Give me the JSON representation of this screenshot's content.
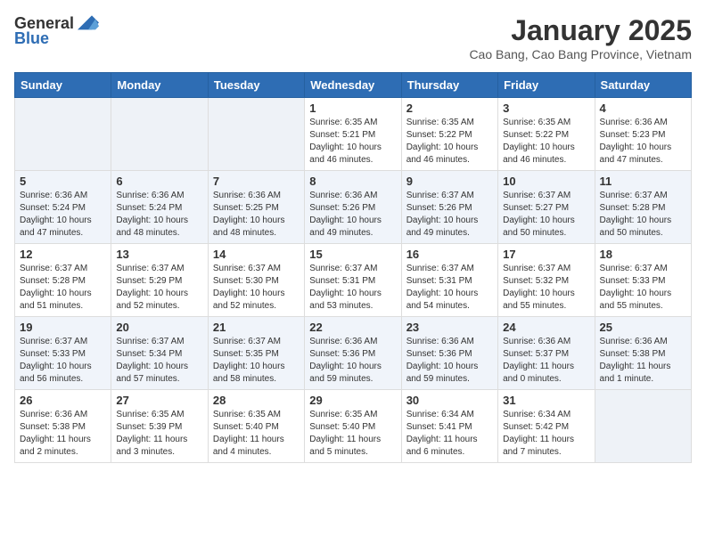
{
  "header": {
    "logo_general": "General",
    "logo_blue": "Blue",
    "month_title": "January 2025",
    "location": "Cao Bang, Cao Bang Province, Vietnam"
  },
  "days_of_week": [
    "Sunday",
    "Monday",
    "Tuesday",
    "Wednesday",
    "Thursday",
    "Friday",
    "Saturday"
  ],
  "weeks": [
    [
      {
        "day": "",
        "info": ""
      },
      {
        "day": "",
        "info": ""
      },
      {
        "day": "",
        "info": ""
      },
      {
        "day": "1",
        "info": "Sunrise: 6:35 AM\nSunset: 5:21 PM\nDaylight: 10 hours\nand 46 minutes."
      },
      {
        "day": "2",
        "info": "Sunrise: 6:35 AM\nSunset: 5:22 PM\nDaylight: 10 hours\nand 46 minutes."
      },
      {
        "day": "3",
        "info": "Sunrise: 6:35 AM\nSunset: 5:22 PM\nDaylight: 10 hours\nand 46 minutes."
      },
      {
        "day": "4",
        "info": "Sunrise: 6:36 AM\nSunset: 5:23 PM\nDaylight: 10 hours\nand 47 minutes."
      }
    ],
    [
      {
        "day": "5",
        "info": "Sunrise: 6:36 AM\nSunset: 5:24 PM\nDaylight: 10 hours\nand 47 minutes."
      },
      {
        "day": "6",
        "info": "Sunrise: 6:36 AM\nSunset: 5:24 PM\nDaylight: 10 hours\nand 48 minutes."
      },
      {
        "day": "7",
        "info": "Sunrise: 6:36 AM\nSunset: 5:25 PM\nDaylight: 10 hours\nand 48 minutes."
      },
      {
        "day": "8",
        "info": "Sunrise: 6:36 AM\nSunset: 5:26 PM\nDaylight: 10 hours\nand 49 minutes."
      },
      {
        "day": "9",
        "info": "Sunrise: 6:37 AM\nSunset: 5:26 PM\nDaylight: 10 hours\nand 49 minutes."
      },
      {
        "day": "10",
        "info": "Sunrise: 6:37 AM\nSunset: 5:27 PM\nDaylight: 10 hours\nand 50 minutes."
      },
      {
        "day": "11",
        "info": "Sunrise: 6:37 AM\nSunset: 5:28 PM\nDaylight: 10 hours\nand 50 minutes."
      }
    ],
    [
      {
        "day": "12",
        "info": "Sunrise: 6:37 AM\nSunset: 5:28 PM\nDaylight: 10 hours\nand 51 minutes."
      },
      {
        "day": "13",
        "info": "Sunrise: 6:37 AM\nSunset: 5:29 PM\nDaylight: 10 hours\nand 52 minutes."
      },
      {
        "day": "14",
        "info": "Sunrise: 6:37 AM\nSunset: 5:30 PM\nDaylight: 10 hours\nand 52 minutes."
      },
      {
        "day": "15",
        "info": "Sunrise: 6:37 AM\nSunset: 5:31 PM\nDaylight: 10 hours\nand 53 minutes."
      },
      {
        "day": "16",
        "info": "Sunrise: 6:37 AM\nSunset: 5:31 PM\nDaylight: 10 hours\nand 54 minutes."
      },
      {
        "day": "17",
        "info": "Sunrise: 6:37 AM\nSunset: 5:32 PM\nDaylight: 10 hours\nand 55 minutes."
      },
      {
        "day": "18",
        "info": "Sunrise: 6:37 AM\nSunset: 5:33 PM\nDaylight: 10 hours\nand 55 minutes."
      }
    ],
    [
      {
        "day": "19",
        "info": "Sunrise: 6:37 AM\nSunset: 5:33 PM\nDaylight: 10 hours\nand 56 minutes."
      },
      {
        "day": "20",
        "info": "Sunrise: 6:37 AM\nSunset: 5:34 PM\nDaylight: 10 hours\nand 57 minutes."
      },
      {
        "day": "21",
        "info": "Sunrise: 6:37 AM\nSunset: 5:35 PM\nDaylight: 10 hours\nand 58 minutes."
      },
      {
        "day": "22",
        "info": "Sunrise: 6:36 AM\nSunset: 5:36 PM\nDaylight: 10 hours\nand 59 minutes."
      },
      {
        "day": "23",
        "info": "Sunrise: 6:36 AM\nSunset: 5:36 PM\nDaylight: 10 hours\nand 59 minutes."
      },
      {
        "day": "24",
        "info": "Sunrise: 6:36 AM\nSunset: 5:37 PM\nDaylight: 11 hours\nand 0 minutes."
      },
      {
        "day": "25",
        "info": "Sunrise: 6:36 AM\nSunset: 5:38 PM\nDaylight: 11 hours\nand 1 minute."
      }
    ],
    [
      {
        "day": "26",
        "info": "Sunrise: 6:36 AM\nSunset: 5:38 PM\nDaylight: 11 hours\nand 2 minutes."
      },
      {
        "day": "27",
        "info": "Sunrise: 6:35 AM\nSunset: 5:39 PM\nDaylight: 11 hours\nand 3 minutes."
      },
      {
        "day": "28",
        "info": "Sunrise: 6:35 AM\nSunset: 5:40 PM\nDaylight: 11 hours\nand 4 minutes."
      },
      {
        "day": "29",
        "info": "Sunrise: 6:35 AM\nSunset: 5:40 PM\nDaylight: 11 hours\nand 5 minutes."
      },
      {
        "day": "30",
        "info": "Sunrise: 6:34 AM\nSunset: 5:41 PM\nDaylight: 11 hours\nand 6 minutes."
      },
      {
        "day": "31",
        "info": "Sunrise: 6:34 AM\nSunset: 5:42 PM\nDaylight: 11 hours\nand 7 minutes."
      },
      {
        "day": "",
        "info": ""
      }
    ]
  ]
}
